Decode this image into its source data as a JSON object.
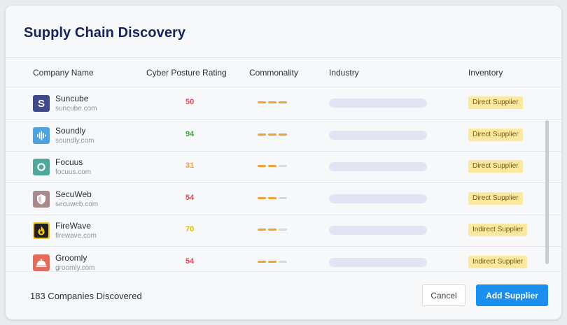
{
  "page": {
    "title": "Supply Chain Discovery"
  },
  "table": {
    "columns": [
      "Company Name",
      "Cyber Posture Rating",
      "Commonality",
      "Industry",
      "Inventory"
    ],
    "rows": [
      {
        "name": "Suncube",
        "domain": "suncube.com",
        "rating": "50",
        "rating_color": "#e5484d",
        "commonality_level": 3,
        "inventory": "Direct Supplier",
        "logo_icon": "letter-s-icon",
        "logo_color": "#3f4a8a"
      },
      {
        "name": "Soundly",
        "domain": "soundly.com",
        "rating": "94",
        "rating_color": "#3aaa35",
        "commonality_level": 3,
        "inventory": "Direct Supplier",
        "logo_icon": "sound-wave-icon",
        "logo_color": "#4da3e0"
      },
      {
        "name": "Focuus",
        "domain": "focuus.com",
        "rating": "31",
        "rating_color": "#f2a035",
        "commonality_level": 2,
        "inventory": "Direct Supplier",
        "logo_icon": "ring-icon",
        "logo_color": "#4fa89a"
      },
      {
        "name": "SecuWeb",
        "domain": "secuweb.com",
        "rating": "54",
        "rating_color": "#e5484d",
        "commonality_level": 2,
        "inventory": "Direct Supplier",
        "logo_icon": "shield-icon",
        "logo_color": "#a88a8a"
      },
      {
        "name": "FireWave",
        "domain": "firewave.com",
        "rating": "70",
        "rating_color": "#e6b800",
        "commonality_level": 2,
        "inventory": "Indirect Supplier",
        "logo_icon": "flame-icon",
        "logo_color": "#f5c518"
      },
      {
        "name": "Groomly",
        "domain": "groomly.com",
        "rating": "54",
        "rating_color": "#e5484d",
        "commonality_level": 2,
        "inventory": "Indirect Supplier",
        "logo_icon": "cloche-icon",
        "logo_color": "#e76b5a"
      }
    ]
  },
  "footer": {
    "count_text": "183 Companies Discovered",
    "cancel_label": "Cancel",
    "add_label": "Add Supplier"
  },
  "colors": {
    "commonality_on": "#f2a035",
    "commonality_off": "#d7d9de",
    "primary": "#1c8ef0",
    "title": "#16225a",
    "badge_bg": "#fde8a0"
  }
}
